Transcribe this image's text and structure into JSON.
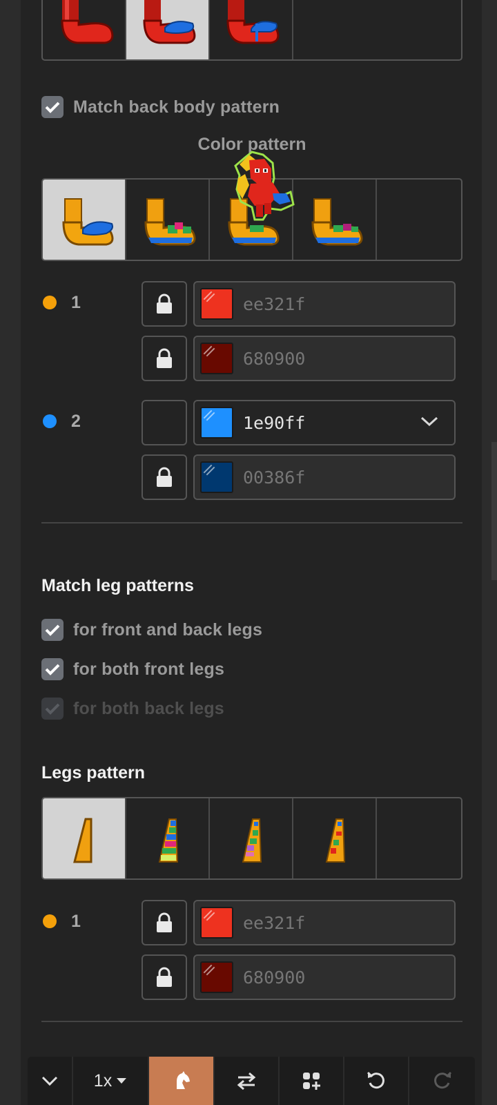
{
  "top_grid": {
    "tiles": [
      "shoe-pattern-1",
      "shoe-pattern-2",
      "shoe-pattern-3",
      "empty"
    ],
    "selected_index": 1
  },
  "match_back_body": {
    "label": "Match back body pattern",
    "checked": true
  },
  "color_pattern": {
    "title": "Color pattern",
    "tiles": [
      "orange-shoe-1",
      "orange-shoe-2",
      "orange-shoe-3",
      "orange-shoe-4",
      "empty"
    ],
    "selected_index": 0
  },
  "color_group_1": {
    "number": "1",
    "dot_color": "#f4a00a",
    "rows": [
      {
        "locked": true,
        "swatch": "#ee321f",
        "hex": "ee321f"
      },
      {
        "locked": true,
        "swatch": "#680900",
        "hex": "680900"
      }
    ]
  },
  "color_group_2": {
    "number": "2",
    "dot_color": "#1e90ff",
    "rows": [
      {
        "locked": false,
        "swatch": "#1e90ff",
        "hex": "1e90ff",
        "active": true
      },
      {
        "locked": true,
        "swatch": "#00386f",
        "hex": "00386f"
      }
    ]
  },
  "match_leg_patterns": {
    "title": "Match leg patterns",
    "options": [
      {
        "label": "for front and back legs",
        "checked": true,
        "disabled": false
      },
      {
        "label": "for both front legs",
        "checked": true,
        "disabled": false
      },
      {
        "label": "for both back legs",
        "checked": true,
        "disabled": true
      }
    ]
  },
  "legs_pattern": {
    "title": "Legs pattern",
    "tiles": [
      "plain-leg",
      "striped-leg-1",
      "striped-leg-2",
      "striped-leg-3",
      "empty"
    ],
    "selected_index": 0
  },
  "legs_color_group_1": {
    "number": "1",
    "dot_color": "#f4a00a",
    "rows": [
      {
        "locked": true,
        "swatch": "#ee321f",
        "hex": "ee321f"
      },
      {
        "locked": true,
        "swatch": "#680900",
        "hex": "680900"
      }
    ]
  },
  "toolbar": {
    "zoom_label": "1x",
    "buttons": [
      "collapse-chevron-icon",
      "zoom-select",
      "pony-icon",
      "swap-arrows-icon",
      "add-grid-icon",
      "undo-icon",
      "redo-icon"
    ],
    "active_color": "#c87c52"
  }
}
